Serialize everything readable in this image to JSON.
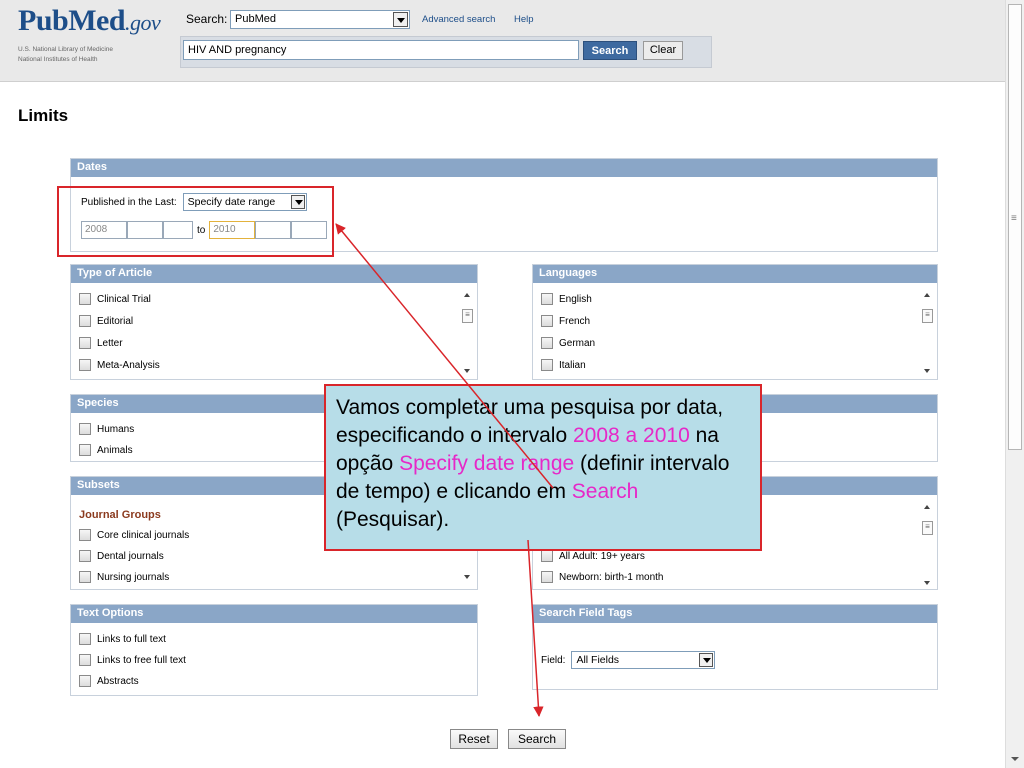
{
  "header": {
    "logo_main": "Pub",
    "logo_med": "Med",
    "logo_gov": ".gov",
    "logo_sub1": "U.S. National Library of Medicine",
    "logo_sub2": "National Institutes of Health",
    "search_label": "Search:",
    "database": "PubMed",
    "advanced_search": "Advanced search",
    "help": "Help",
    "query": "HIV AND pregnancy",
    "search_button": "Search",
    "clear_button": "Clear"
  },
  "page_title": "Limits",
  "dates": {
    "title": "Dates",
    "published_label": "Published in the Last:",
    "range_option": "Specify date range",
    "from_year": "2008",
    "to_label": "to",
    "to_year": "2010"
  },
  "type_of_article": {
    "title": "Type of Article",
    "items": [
      "Clinical Trial",
      "Editorial",
      "Letter",
      "Meta-Analysis"
    ]
  },
  "languages": {
    "title": "Languages",
    "items": [
      "English",
      "French",
      "German",
      "Italian"
    ]
  },
  "species": {
    "title": "Species",
    "items": [
      "Humans",
      "Animals"
    ]
  },
  "subsets": {
    "title": "Subsets",
    "group": "Journal Groups",
    "items": [
      "Core clinical journals",
      "Dental journals",
      "Nursing journals"
    ]
  },
  "ages": {
    "items": [
      "All Adult: 19+ years",
      "Newborn: birth-1 month"
    ]
  },
  "text_options": {
    "title": "Text Options",
    "items": [
      "Links to full text",
      "Links to free full text",
      "Abstracts"
    ]
  },
  "search_field_tags": {
    "title": "Search Field Tags",
    "field_label": "Field:",
    "field_value": "All Fields"
  },
  "footer": {
    "reset": "Reset",
    "search": "Search"
  },
  "annotation": {
    "part1": "Vamos completar uma pesquisa por data, especificando o intervalo ",
    "hl1": "2008 a 2010",
    "part2": " na opção ",
    "hl2": "Specify date range",
    "part3": " (definir intervalo de tempo) e clicando em ",
    "hl3": "Search",
    "part4": " (Pesquisar)."
  },
  "colors": {
    "panel_header": "#8aa6c7",
    "callout_bg": "#b7dde8",
    "highlight": "#e628c8",
    "annotation_red": "#d9252a"
  }
}
